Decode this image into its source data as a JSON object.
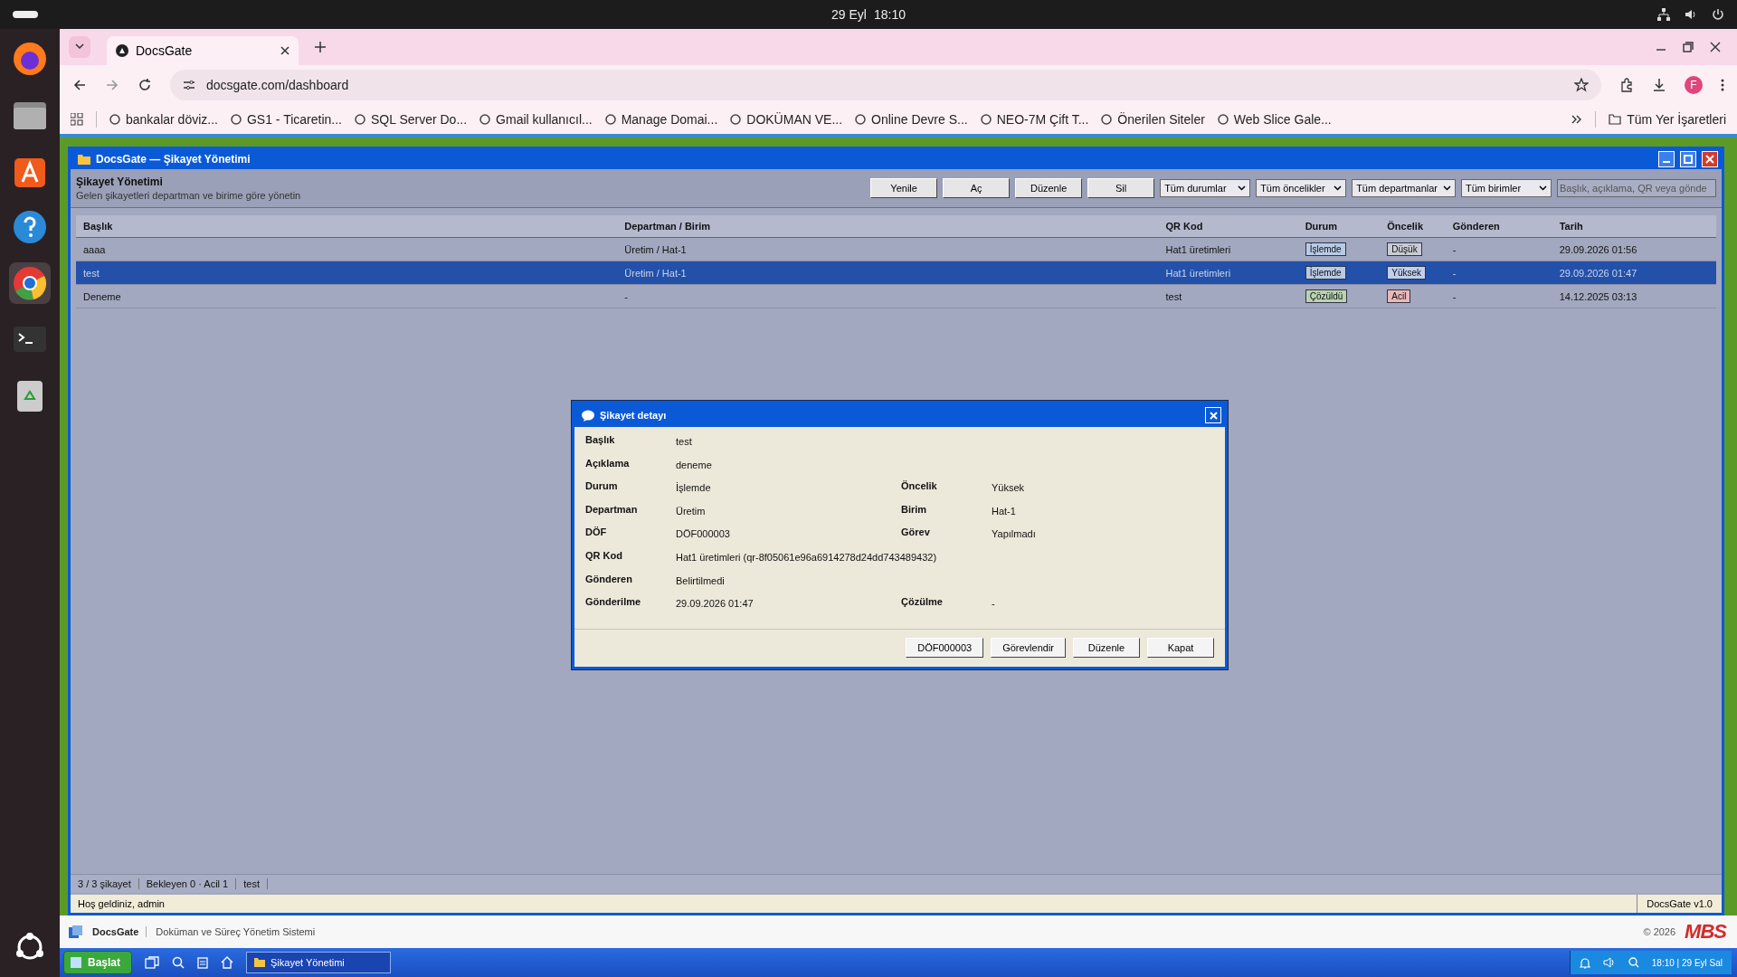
{
  "system_bar": {
    "date": "29 Eyl",
    "time": "18:10"
  },
  "browser": {
    "tab_title": "DocsGate",
    "url": "docsgate.com/dashboard",
    "profile_initial": "F",
    "bookmarks": [
      {
        "label": "bankalar döviz..."
      },
      {
        "label": "GS1 - Ticaretin..."
      },
      {
        "label": "SQL Server Do..."
      },
      {
        "label": "Gmail kullanıcıl..."
      },
      {
        "label": "Manage Domai..."
      },
      {
        "label": "DOKÜMAN VE..."
      },
      {
        "label": "Online Devre S..."
      },
      {
        "label": "NEO-7M Çift T..."
      },
      {
        "label": "Önerilen Siteler"
      },
      {
        "label": "Web Slice Gale..."
      }
    ],
    "all_bookmarks": "Tüm Yer İşaretleri"
  },
  "window": {
    "title": "DocsGate — Şikayet Yönetimi",
    "heading": "Şikayet Yönetimi",
    "subheading": "Gelen şikayetleri departman ve birime göre yönetin",
    "toolbar_buttons": [
      "Yenile",
      "Aç",
      "Düzenle",
      "Sil"
    ],
    "filters": [
      "Tüm durumlar",
      "Tüm öncelikler",
      "Tüm departmanlar",
      "Tüm birimler"
    ],
    "search": {
      "placeholder": "Başlık, açıklama, QR veya gönde"
    }
  },
  "table": {
    "columns": [
      "Başlık",
      "Departman / Birim",
      "QR Kod",
      "Durum",
      "Öncelik",
      "Gönderen",
      "Tarih"
    ],
    "rows": [
      {
        "title": "aaaa",
        "department": "Üretim / Hat-1",
        "qr": "Hat1 üretimleri",
        "status": {
          "text": "İşlemde",
          "color": "#b8cbe6"
        },
        "priority": {
          "text": "Düşük",
          "color": "#c9ccd4"
        },
        "sender": "-",
        "date": "29.09.2026 01:56",
        "selected": false
      },
      {
        "title": "test",
        "department": "Üretim / Hat-1",
        "qr": "Hat1 üretimleri",
        "status": {
          "text": "İşlemde",
          "color": "#b8cbe6"
        },
        "priority": {
          "text": "Yüksek",
          "color": "#c0cff0"
        },
        "sender": "-",
        "date": "29.09.2026 01:47",
        "selected": true
      },
      {
        "title": "Deneme",
        "department": "-",
        "qr": "test",
        "status": {
          "text": "Çözüldü",
          "color": "#b9d3b2"
        },
        "priority": {
          "text": "Acil",
          "color": "#e9b8b8"
        },
        "sender": "-",
        "date": "14.12.2025 03:13",
        "selected": false
      }
    ]
  },
  "status_bar": [
    "3 / 3 şikayet",
    "Bekleyen 0 · Acil 1",
    "test"
  ],
  "welcome": "Hoş geldiniz, admin",
  "version": "DocsGate v1.0",
  "dialog": {
    "title": "Şikayet detayı",
    "rows": [
      [
        {
          "label": "Başlık",
          "value": "test"
        }
      ],
      [
        {
          "label": "Açıklama",
          "value": "deneme"
        }
      ],
      [
        {
          "label": "Durum",
          "value": "İşlemde"
        },
        {
          "label": "Öncelik",
          "value": "Yüksek"
        }
      ],
      [
        {
          "label": "Departman",
          "value": "Üretim"
        },
        {
          "label": "Birim",
          "value": "Hat-1"
        }
      ],
      [
        {
          "label": "DÖF",
          "value": "DÖF000003"
        },
        {
          "label": "Görev",
          "value": "Yapılmadı"
        }
      ],
      [
        {
          "label": "QR Kod",
          "value": "Hat1 üretimleri (qr-8f05061e96a6914278d24dd743489432)"
        }
      ],
      [
        {
          "label": "Gönderen",
          "value": "Belirtilmedi"
        }
      ],
      [
        {
          "label": "Gönderilme",
          "value": "29.09.2026 01:47"
        },
        {
          "label": "Çözülme",
          "value": "-"
        }
      ]
    ],
    "buttons": [
      "DÖF000003",
      "Görevlendir",
      "Düzenle",
      "Kapat"
    ]
  },
  "footer": {
    "brand": "DocsGate",
    "tagline": "Doküman ve Süreç Yönetim Sistemi",
    "copyright": "© 2026",
    "logo_text": "MBS"
  },
  "taskbar": {
    "start": "Başlat",
    "task": "Şikayet Yönetimi",
    "clock": "18:10 | 29 Eyl Sal"
  }
}
